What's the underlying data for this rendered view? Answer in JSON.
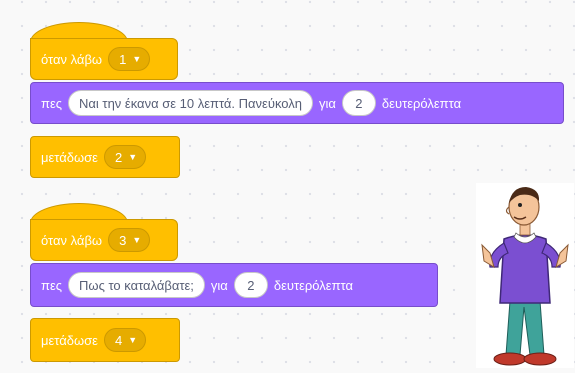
{
  "scripts": [
    {
      "hat": {
        "label": "όταν λάβω",
        "message": "1"
      },
      "say": {
        "label": "πες",
        "text": "Ναι την έκανα σε 10 λεπτά. Πανεύκολη",
        "for_label": "για",
        "seconds": "2",
        "unit": "δευτερόλεπτα"
      },
      "broadcast": {
        "label": "μετάδωσε",
        "message": "2"
      }
    },
    {
      "hat": {
        "label": "όταν λάβω",
        "message": "3"
      },
      "say": {
        "label": "πες",
        "text": "Πως το καταλάβατε;",
        "for_label": "για",
        "seconds": "2",
        "unit": "δευτερόλεπτα"
      },
      "broadcast": {
        "label": "μετάδωσε",
        "message": "4"
      }
    }
  ],
  "colors": {
    "events": "#ffbf00",
    "looks": "#9966ff",
    "background": "#f9f9f9"
  },
  "sprite": {
    "icon": "man-shrugging-sprite"
  }
}
